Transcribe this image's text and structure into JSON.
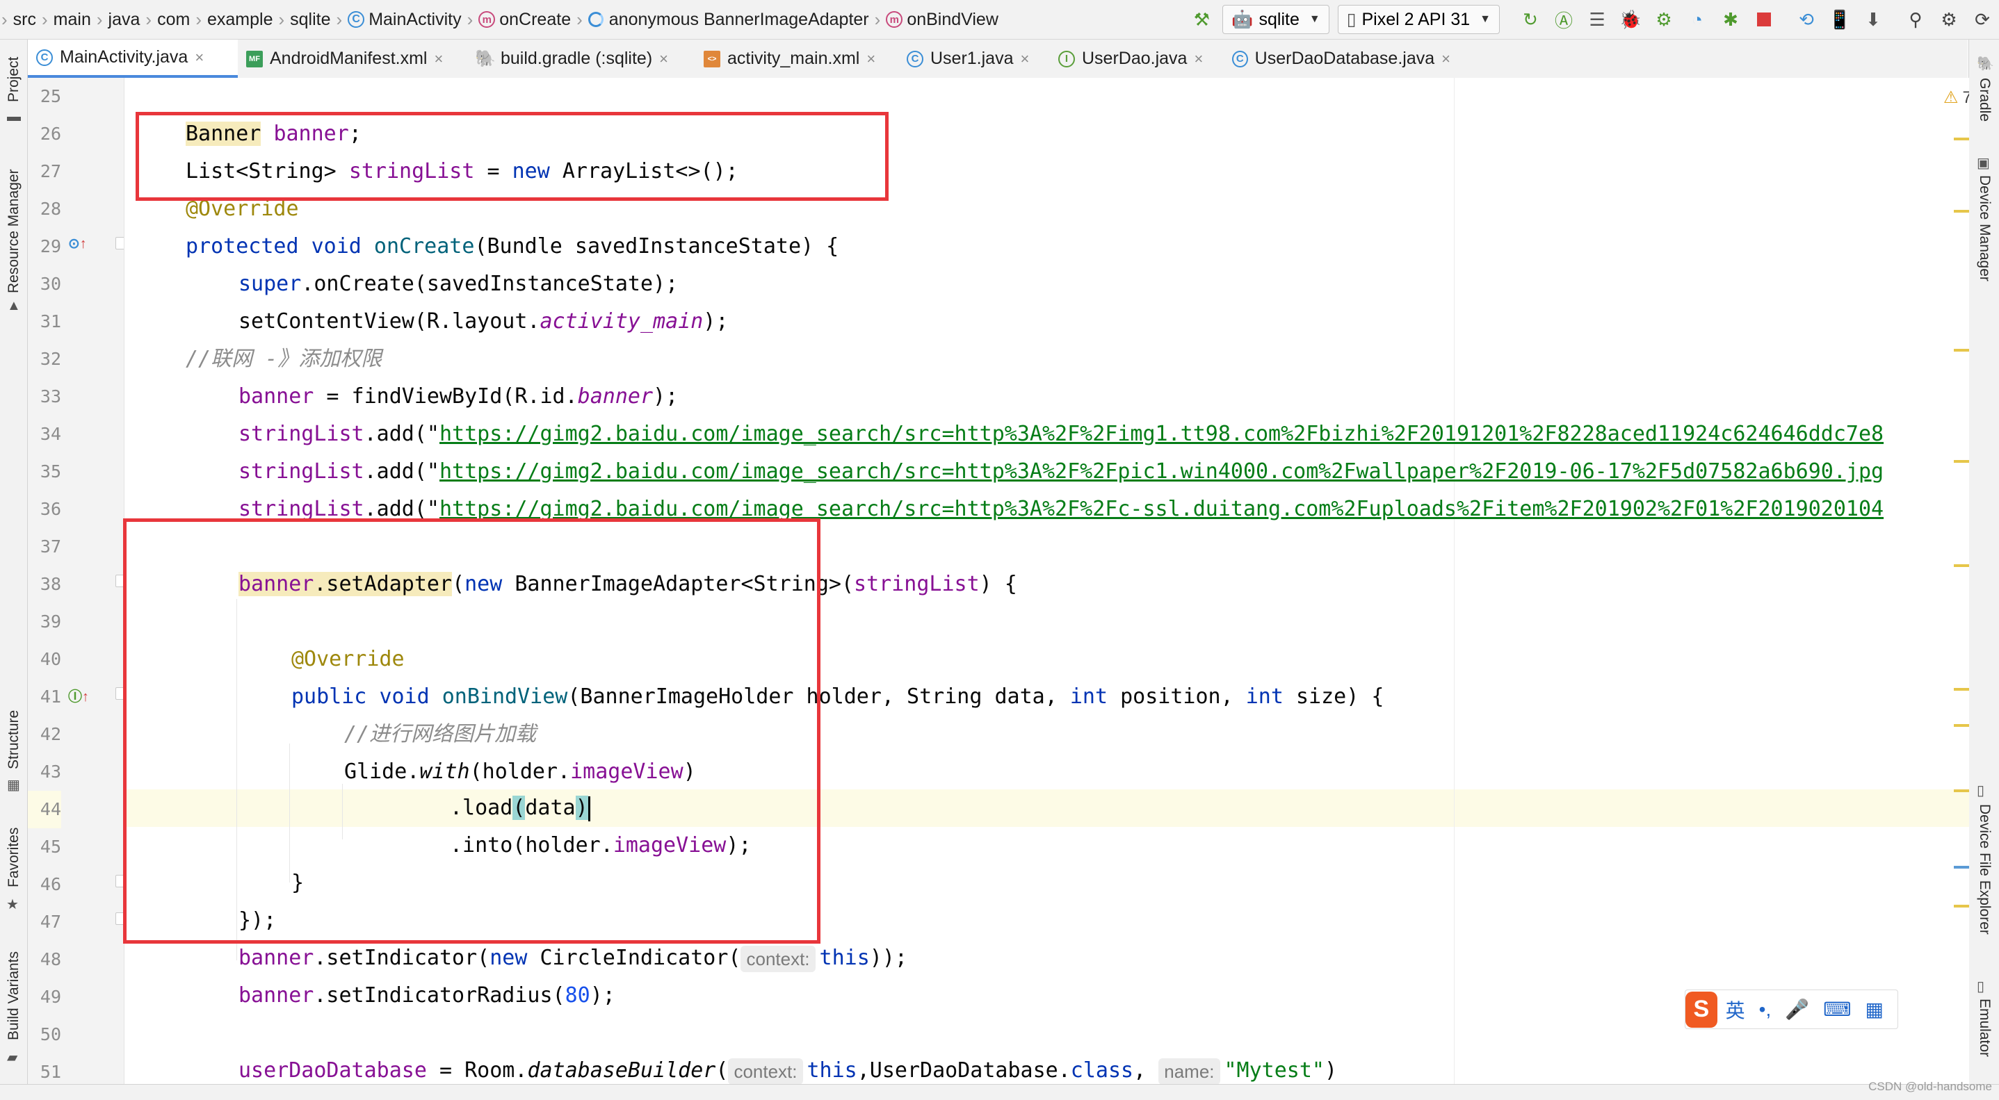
{
  "breadcrumbs": [
    "src",
    "main",
    "java",
    "com",
    "example",
    "sqlite",
    "MainActivity",
    "onCreate",
    "anonymous BannerImageAdapter",
    "onBindView"
  ],
  "toolbar": {
    "module": "sqlite",
    "device": "Pixel 2 API 31",
    "icons": [
      "hammer-icon",
      "android-icon",
      "rerun-icon",
      "apply-changes-icon",
      "coverage-icon",
      "debug-icon",
      "attach-debugger-icon",
      "profile-icon",
      "stop-icon",
      "sync-icon",
      "device-manager-icon",
      "sdk-manager-icon",
      "search-icon",
      "settings-icon",
      "update-icon"
    ]
  },
  "tabs": [
    {
      "label": "MainActivity.java",
      "icon": "c",
      "active": true
    },
    {
      "label": "AndroidManifest.xml",
      "icon": "mf"
    },
    {
      "label": "build.gradle (:sqlite)",
      "icon": "gradle"
    },
    {
      "label": "activity_main.xml",
      "icon": "xml"
    },
    {
      "label": "User1.java",
      "icon": "c"
    },
    {
      "label": "UserDao.java",
      "icon": "i"
    },
    {
      "label": "UserDaoDatabase.java",
      "icon": "c"
    }
  ],
  "left_tools": [
    "Project",
    "Resource Manager",
    "Structure",
    "Favorites",
    "Build Variants"
  ],
  "right_tools": [
    "Gradle",
    "Device Manager",
    "Device File Explorer",
    "Emulator"
  ],
  "inspections": {
    "warnings": "7",
    "checks": "1"
  },
  "line_numbers": [
    "25",
    "26",
    "27",
    "28",
    "29",
    "30",
    "31",
    "32",
    "33",
    "34",
    "35",
    "36",
    "37",
    "38",
    "39",
    "40",
    "41",
    "42",
    "43",
    "44",
    "45",
    "46",
    "47",
    "48",
    "49",
    "50",
    "51"
  ],
  "code": {
    "l26": {
      "type": "Banner",
      "rest": " ",
      "field": "banner",
      "end": ";"
    },
    "l27": {
      "a": "List<String> ",
      "field": "stringList",
      "b": " = ",
      "kw": "new",
      "c": " ArrayList<>();"
    },
    "l28": {
      "ann": "@Override"
    },
    "l29": {
      "kw1": "protected",
      "sp": " ",
      "kw2": "void",
      "fn": " onCreate",
      "rest": "(Bundle savedInstanceState) {"
    },
    "l30": {
      "kw": "super",
      "rest": ".onCreate(savedInstanceState);"
    },
    "l31": {
      "a": "setContentView(R.layout.",
      "it": "activity_main",
      "b": ");"
    },
    "l32": {
      "cmt": "//联网 -》添加权限"
    },
    "l33": {
      "field": "banner",
      "a": " = findViewById(R.id.",
      "it": "banner",
      "b": ");"
    },
    "l34": {
      "field": "stringList",
      "a": ".add(\"",
      "str": "https://gimg2.baidu.com/image_search/src=http%3A%2F%2Fimg1.tt98.com%2Fbizhi%2F20191201%2F8228aced11924c624646ddc7e8"
    },
    "l35": {
      "field": "stringList",
      "a": ".add(\"",
      "str": "https://gimg2.baidu.com/image_search/src=http%3A%2F%2Fpic1.win4000.com%2Fwallpaper%2F2019-06-17%2F5d07582a6b690.jpg"
    },
    "l36": {
      "field": "stringList",
      "a": ".add(\"",
      "str": "https://gimg2.baidu.com/image_search/src=http%3A%2F%2Fc-ssl.duitang.com%2Fuploads%2Fitem%2F201902%2F01%2F2019020104"
    },
    "l38": {
      "field": "banner",
      "method": ".setAdapter",
      "a": "(",
      "kw": "new",
      "b": " BannerImageAdapter<String>(",
      "field2": "stringList",
      "c": ") {"
    },
    "l40": {
      "ann": "@Override"
    },
    "l41": {
      "kw1": "public",
      "kw2": "void",
      "fn": "onBindView",
      "a": "(BannerImageHolder holder, String data, ",
      "kw3": "int",
      "b": " position, ",
      "kw4": "int",
      "c": " size) {"
    },
    "l42": {
      "cmt": "//进行网络图片加载"
    },
    "l43": {
      "a": "Glide.",
      "it": "with",
      "b": "(holder.",
      "field": "imageView",
      "c": ")"
    },
    "l44": {
      "a": ".load",
      "p1": "(",
      "b": "data",
      "p2": ")"
    },
    "l45": {
      "a": ".into(holder.",
      "field": "imageView",
      "b": ");"
    },
    "l46": {
      "a": "}"
    },
    "l47": {
      "a": "});"
    },
    "l48": {
      "field": "banner",
      "a": ".setIndicator(",
      "kw": "new",
      "b": " CircleIndicator(",
      "hint": "context:",
      "kw2": "this",
      "c": "));"
    },
    "l49": {
      "field": "banner",
      "a": ".setIndicatorRadius(",
      "num": "80",
      "b": ");"
    },
    "l51": {
      "field": "userDaoDatabase",
      "a": " = Room.",
      "it": "databaseBuilder",
      "b": "(",
      "hint1": "context:",
      "kw": "this",
      "c": ",UserDaoDatabase.",
      "kw2": "class",
      "d": ", ",
      "hint2": "name:",
      "str": "\"Mytest\"",
      "e": ")"
    }
  },
  "ime": {
    "lang": "英",
    "punct": "•,",
    "mic": "🎤",
    "kbd": "⌨",
    "grid": "▦"
  },
  "watermark": "CSDN @old-handsome",
  "colors": {
    "annotation_box": "#e8363b",
    "keyword": "#0033b3",
    "field": "#871094",
    "string": "#067d17"
  }
}
